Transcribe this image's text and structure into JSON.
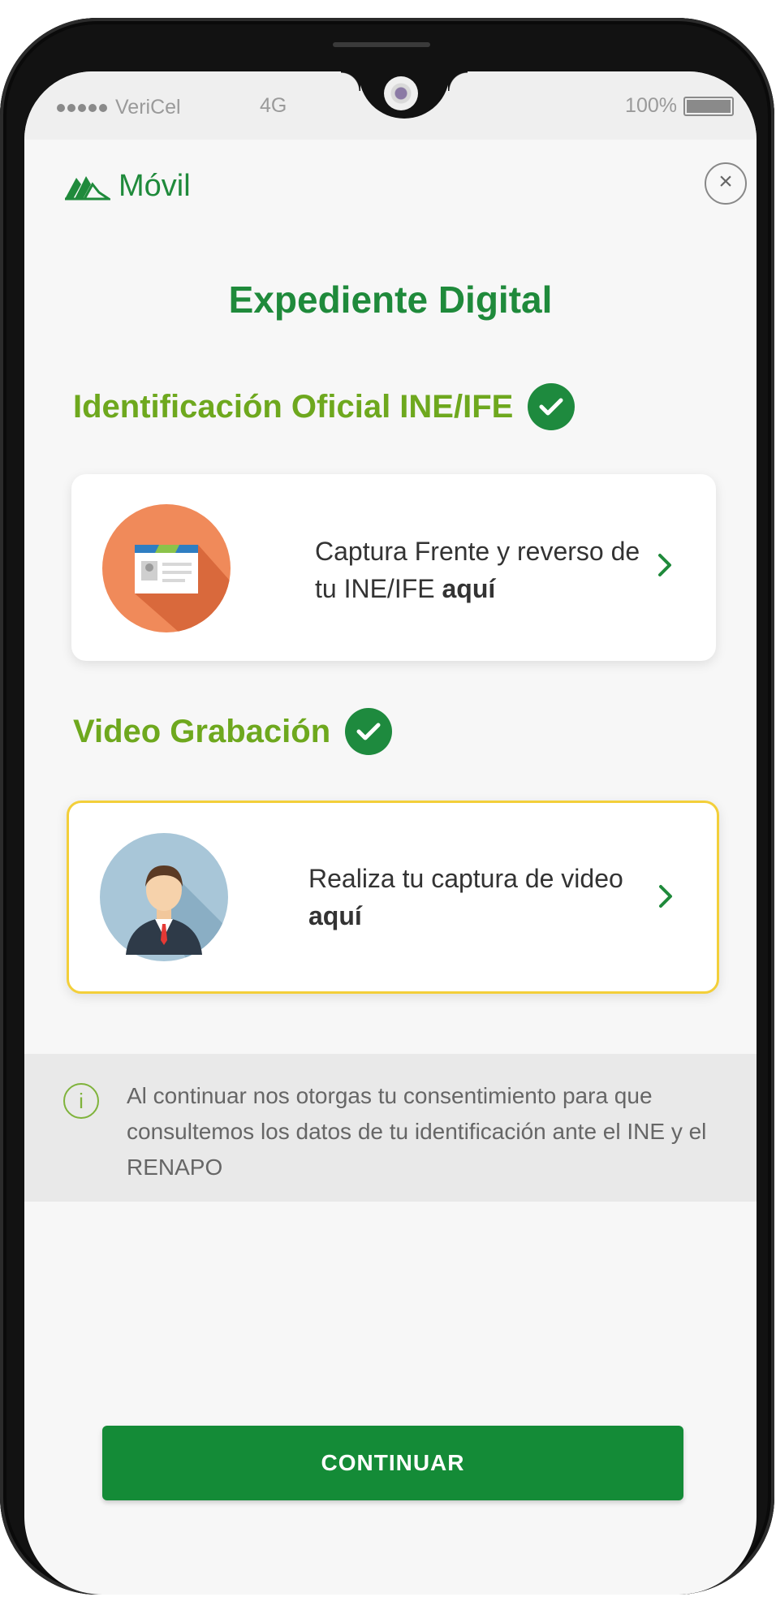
{
  "status_bar": {
    "carrier": "VeriCel",
    "network": "4G",
    "battery": "100%"
  },
  "header": {
    "brand": "Móvil",
    "close_label": "×"
  },
  "page_title": "Expediente Digital",
  "sections": [
    {
      "title": "Identificación Oficial INE/IFE",
      "completed": true,
      "card": {
        "text_main": "Captura Frente y reverso de tu INE/IFE ",
        "text_bold": "aquí",
        "icon": "id-card-icon"
      }
    },
    {
      "title": "Video Grabación",
      "completed": true,
      "card": {
        "text_main": "Realiza tu captura de video ",
        "text_bold": "aquí",
        "icon": "person-avatar-icon"
      }
    }
  ],
  "notice": {
    "icon": "info-icon",
    "text": "Al continuar nos otorgas tu consentimiento para que consultemos los datos de tu identificación ante el INE y el RENAPO"
  },
  "continue_button": "CONTINUAR",
  "colors": {
    "brand_green": "#1f8a3b",
    "section_green": "#6ea81e",
    "button_green": "#148b37",
    "highlight_yellow": "#f3cf3a"
  }
}
